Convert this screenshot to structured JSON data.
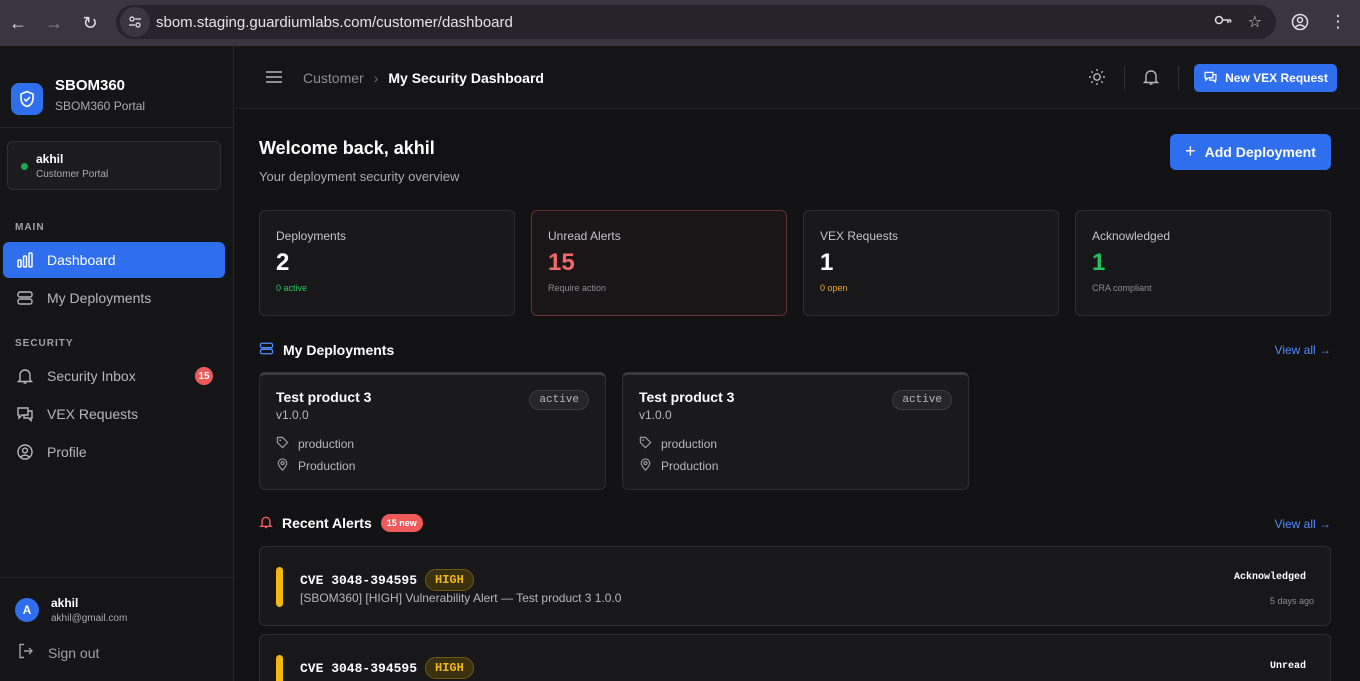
{
  "browser": {
    "url": "sbom.staging.guardiumlabs.com/customer/dashboard"
  },
  "brand": {
    "title": "SBOM360",
    "subtitle": "SBOM360 Portal"
  },
  "user_card": {
    "name": "akhil",
    "role": "Customer Portal",
    "status_color": "#22a453"
  },
  "sidebar": {
    "main_label": "MAIN",
    "main_items": [
      {
        "label": "Dashboard",
        "icon": "bar-chart-icon",
        "active": true
      },
      {
        "label": "My Deployments",
        "icon": "database-icon",
        "active": false
      }
    ],
    "security_label": "SECURITY",
    "security_items": [
      {
        "label": "Security Inbox",
        "icon": "bell-icon",
        "badge": "15"
      },
      {
        "label": "VEX Requests",
        "icon": "chat-icon"
      },
      {
        "label": "Profile",
        "icon": "user-circle-icon"
      }
    ],
    "footer": {
      "avatar_letter": "A",
      "name": "akhil",
      "email": "akhil@gmail.com",
      "signout_label": "Sign out"
    }
  },
  "header": {
    "breadcrumb_parent": "Customer",
    "breadcrumb_current": "My Security Dashboard",
    "vex_button_label": "New VEX Request"
  },
  "main": {
    "welcome_title": "Welcome back, akhil",
    "welcome_subtitle": "Your deployment security overview",
    "add_button_label": "Add Deployment",
    "stats": [
      {
        "label": "Deployments",
        "value": "2",
        "sub": "0 active",
        "value_color": "#ffffff",
        "sub_color": "#22c55e"
      },
      {
        "label": "Unread Alerts",
        "value": "15",
        "sub": "Require action",
        "value_color": "#f06a6a",
        "sub_color": "#8c8c94"
      },
      {
        "label": "VEX Requests",
        "value": "1",
        "sub": "0 open",
        "value_color": "#ffffff",
        "sub_color": "#f5a524"
      },
      {
        "label": "Acknowledged",
        "value": "1",
        "sub": "CRA compliant",
        "value_color": "#22c55e",
        "sub_color": "#8c8c94"
      }
    ],
    "deployments_title": "My Deployments",
    "deployments_view_all": "View all →",
    "deployments": [
      {
        "name": "Test product 3",
        "version": "v1.0.0",
        "status": "active",
        "tag": "production",
        "environment": "Production"
      },
      {
        "name": "Test product 3",
        "version": "v1.0.0",
        "status": "active",
        "tag": "production",
        "environment": "Production"
      }
    ],
    "alerts_title": "Recent Alerts",
    "alerts_new_badge": "15 new",
    "alerts_view_all": "View all →",
    "alerts": [
      {
        "cve": "CVE 3048-394595",
        "severity": "HIGH",
        "description": "[SBOM360] [HIGH] Vulnerability Alert — Test product 3 1.0.0",
        "state": "Acknowledged",
        "time": "5 days ago"
      },
      {
        "cve": "CVE 3048-394595",
        "severity": "HIGH",
        "description": "",
        "state": "Unread",
        "time": ""
      }
    ]
  },
  "colors": {
    "accent": "#2f6fed",
    "danger": "#ee5a5a",
    "warning": "#f5b80c"
  }
}
